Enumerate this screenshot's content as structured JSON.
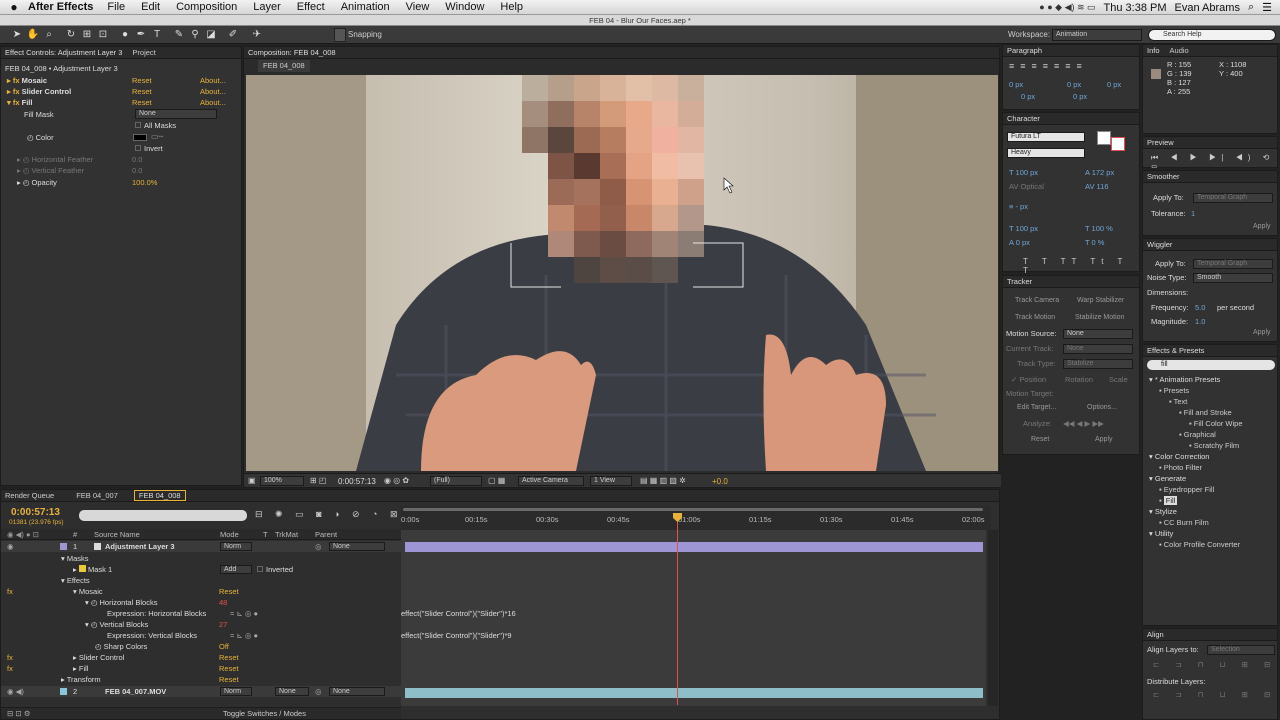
{
  "menu": {
    "app": "After Effects",
    "items": [
      "File",
      "Edit",
      "Composition",
      "Layer",
      "Effect",
      "Animation",
      "View",
      "Window",
      "Help"
    ],
    "window_title": "FEB 04 - Blur Our Faces.aep *",
    "clock": "Thu 3:38 PM",
    "user": "Evan Abrams"
  },
  "toolbar": {
    "snapping": "Snapping",
    "workspace_label": "Workspace:",
    "workspace_value": "Animation",
    "search_placeholder": "Search Help"
  },
  "effect_controls": {
    "tab": "Effect Controls: Adjustment Layer 3",
    "tab2": "Project",
    "title": "FEB 04_008 • Adjustment Layer 3",
    "rows": [
      {
        "name": "Mosaic",
        "reset": "Reset",
        "about": "About..."
      },
      {
        "name": "Slider Control",
        "reset": "Reset",
        "about": "About..."
      },
      {
        "name": "Fill",
        "reset": "Reset",
        "about": "About..."
      }
    ],
    "fill_mask_label": "Fill Mask",
    "fill_mask_value": "None",
    "all_masks": "All Masks",
    "color": "Color",
    "invert": "Invert",
    "h_feather": "Horizontal Feather",
    "h_feather_val": "0.0",
    "v_feather": "Vertical Feather",
    "v_feather_val": "0.0",
    "opacity": "Opacity",
    "opacity_val": "100.0%"
  },
  "composition": {
    "tab": "Composition: FEB 04_008",
    "subtab": "FEB 04_008",
    "zoom": "100%",
    "time": "0:00:57:13",
    "res": "(Full)",
    "camera": "Active Camera",
    "view": "1 View",
    "exposure": "+0.0"
  },
  "timeline": {
    "tabs": [
      "Render Queue",
      "FEB 04_007",
      "FEB 04_008"
    ],
    "time": "0:00:57:13",
    "frames": "01381 (23.976 fps)",
    "headers": {
      "num": "#",
      "source": "Source Name",
      "mode": "Mode",
      "t": "T",
      "trkmat": "TrkMat",
      "parent": "Parent"
    },
    "ruler": [
      "0:00s",
      "00:15s",
      "00:30s",
      "00:45s",
      "01:00s",
      "01:15s",
      "01:30s",
      "01:45s",
      "02:00s"
    ],
    "layer3": {
      "num": "1",
      "name": "Adjustment Layer 3",
      "mode": "Norm",
      "parent": "None"
    },
    "masks": "Masks",
    "mask1": "Mask 1",
    "mask_mode": "Add",
    "inverted": "Inverted",
    "effects": "Effects",
    "mosaic": "Mosaic",
    "reset": "Reset",
    "hblocks": "Horizontal Blocks",
    "hblocks_val": "48",
    "expr_h": "Expression: Horizontal Blocks",
    "expr_h_code": "effect(\"Slider Control\")(\"Slider\")*16",
    "vblocks": "Vertical Blocks",
    "vblocks_val": "27",
    "expr_v": "Expression: Vertical Blocks",
    "expr_v_code": "effect(\"Slider Control\")(\"Slider\")*9",
    "sharp": "Sharp Colors",
    "sharp_val": "Off",
    "slider": "Slider Control",
    "fill": "Fill",
    "transform": "Transform",
    "layer2": {
      "num": "2",
      "name": "FEB 04_007.MOV",
      "mode": "Norm",
      "trkmat": "None",
      "parent": "None"
    },
    "toggle": "Toggle Switches / Modes"
  },
  "paragraph": {
    "tab": "Paragraph",
    "vals": [
      "0 px",
      "0 px",
      "0 px",
      "0 px",
      "0 px"
    ]
  },
  "character": {
    "tab": "Character",
    "font": "Futura LT",
    "style": "Heavy",
    "size": "100 px",
    "leading": "172 px",
    "kern": "Optical",
    "track": "116",
    "px": "- px",
    "vscale": "100 px",
    "hscale": "100 %",
    "baseline": "0 px",
    "tsume": "0 %"
  },
  "tracker": {
    "tab": "Tracker",
    "track_camera": "Track Camera",
    "warp": "Warp Stabilizer",
    "track_motion": "Track Motion",
    "stabilize": "Stabilize Motion",
    "motion_source": "Motion Source:",
    "motion_source_val": "None",
    "current_track": "Current Track:",
    "current_track_val": "None",
    "track_type": "Track Type:",
    "track_type_val": "Stabilize",
    "position": "Position",
    "rotation": "Rotation",
    "scale": "Scale",
    "motion_target": "Motion Target:",
    "edit_target": "Edit Target...",
    "options": "Options...",
    "analyze": "Analyze:",
    "reset": "Reset",
    "apply": "Apply"
  },
  "info": {
    "tab": "Info",
    "tab2": "Audio",
    "r": "R : 155",
    "g": "G : 139",
    "b": "B : 127",
    "a": "A : 255",
    "x": "X : 1108",
    "y": "Y : 400",
    "swatch": "#9b8b7f"
  },
  "preview": {
    "tab": "Preview"
  },
  "smoother": {
    "tab": "Smoother",
    "apply_to": "Apply To:",
    "apply_to_val": "Temporal Graph",
    "tolerance": "Tolerance:",
    "tolerance_val": "1",
    "apply": "Apply"
  },
  "wiggler": {
    "tab": "Wiggler",
    "apply_to": "Apply To:",
    "apply_to_val": "Temporal Graph",
    "noise": "Noise Type:",
    "noise_val": "Smooth",
    "dims": "Dimensions:",
    "freq": "Frequency:",
    "freq_val": "5.0",
    "per_sec": "per second",
    "mag": "Magnitude:",
    "mag_val": "1.0",
    "apply": "Apply"
  },
  "effects_presets": {
    "tab": "Effects & Presets",
    "search": "fill",
    "tree": [
      {
        "label": "* Animation Presets",
        "lvl": 0
      },
      {
        "label": "Presets",
        "lvl": 1
      },
      {
        "label": "Text",
        "lvl": 2
      },
      {
        "label": "Fill and Stroke",
        "lvl": 3
      },
      {
        "label": "Fill Color Wipe",
        "lvl": 4
      },
      {
        "label": "Graphical",
        "lvl": 3
      },
      {
        "label": "Scratchy Film",
        "lvl": 4
      },
      {
        "label": "Color Correction",
        "lvl": 0
      },
      {
        "label": "Photo Filter",
        "lvl": 1
      },
      {
        "label": "Generate",
        "lvl": 0
      },
      {
        "label": "Eyedropper Fill",
        "lvl": 1
      },
      {
        "label": "Fill",
        "lvl": 1
      },
      {
        "label": "Stylize",
        "lvl": 0
      },
      {
        "label": "CC Burn Film",
        "lvl": 1
      },
      {
        "label": "Utility",
        "lvl": 0
      },
      {
        "label": "Color Profile Converter",
        "lvl": 1
      }
    ]
  },
  "align": {
    "tab": "Align",
    "align_to": "Align Layers to:",
    "align_to_val": "Selection",
    "distribute": "Distribute Layers:"
  }
}
